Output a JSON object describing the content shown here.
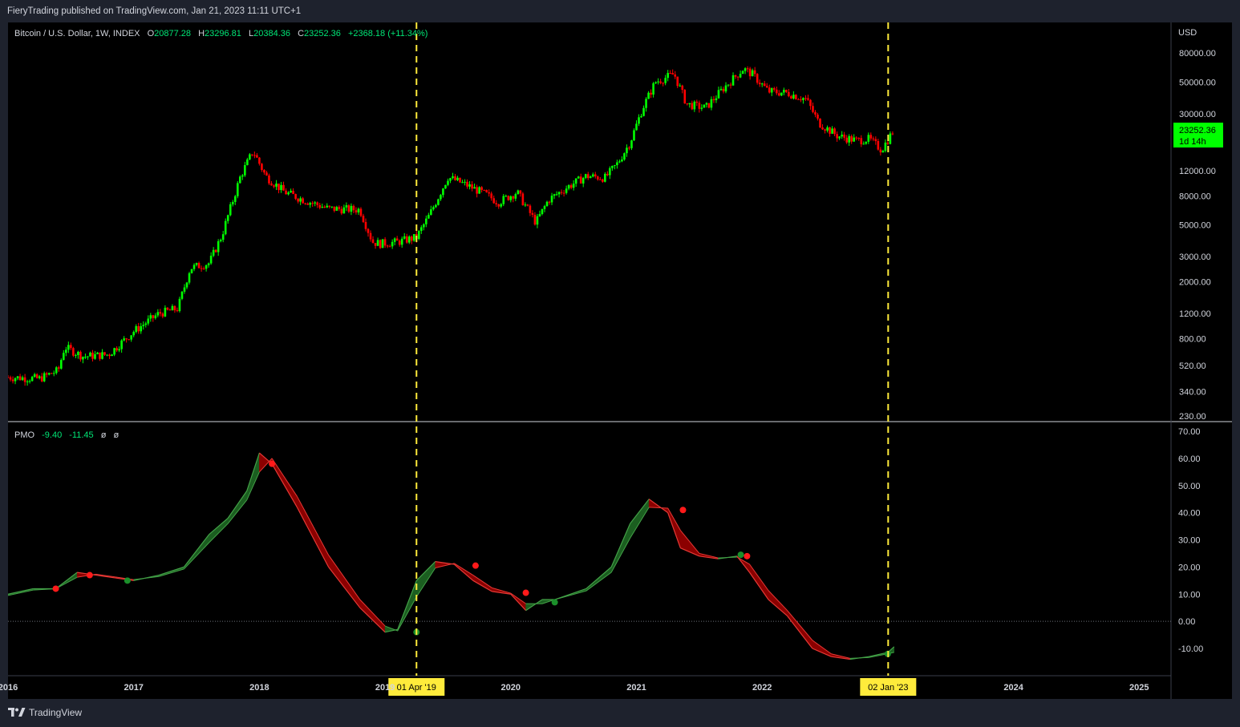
{
  "header": {
    "published": "FieryTrading published on TradingView.com, Jan 21, 2023 11:11 UTC+1"
  },
  "legend": {
    "symbol": "Bitcoin / U.S. Dollar, 1W, INDEX",
    "open_label": "O",
    "open": "20877.28",
    "high_label": "H",
    "high": "23296.81",
    "low_label": "L",
    "low": "20384.36",
    "close_label": "C",
    "close": "23252.36",
    "change": "+2368.18 (+11.34%)"
  },
  "pmo_legend": {
    "name": "PMO",
    "v1": "-9.40",
    "v2": "-11.45",
    "v3": "ø",
    "v4": "ø"
  },
  "price_axis": {
    "currency": "USD",
    "last_price": "23252.36",
    "countdown": "1d 14h"
  },
  "time_markers": [
    {
      "label": "01 Apr '19",
      "date": "2019-04-01"
    },
    {
      "label": "02 Jan '23",
      "date": "2023-01-02"
    }
  ],
  "footer": {
    "brand": "TradingView"
  },
  "colors": {
    "background": "#000000",
    "frame": "#1e222d",
    "bull": "#00ff00",
    "bear": "#ff0000",
    "marker": "#ffeb3b",
    "pmo_up_fill": "#1b5e20",
    "pmo_down_fill": "#8b0000"
  },
  "chart_data": [
    {
      "type": "line",
      "title": "Bitcoin / U.S. Dollar, 1W, INDEX",
      "ylabel": "USD",
      "y_scale": "log",
      "ylim": [
        230,
        100000
      ],
      "y_ticks": [
        "80000.00",
        "50000.00",
        "30000.00",
        "12000.00",
        "8000.00",
        "5000.00",
        "3000.00",
        "2000.00",
        "1200.00",
        "800.00",
        "520.00",
        "340.00",
        "230.00"
      ],
      "x_ticks": [
        "2016",
        "2017",
        "2018",
        "2019",
        "2020",
        "2021",
        "2022",
        "2024",
        "2025"
      ],
      "x": [
        2016.0,
        2016.25,
        2016.4,
        2016.45,
        2016.6,
        2016.8,
        2017.0,
        2017.2,
        2017.35,
        2017.45,
        2017.6,
        2017.7,
        2017.85,
        2017.95,
        2018.05,
        2018.2,
        2018.35,
        2018.55,
        2018.8,
        2018.9,
        2018.96,
        2019.1,
        2019.25,
        2019.35,
        2019.5,
        2019.65,
        2019.8,
        2019.9,
        2020.05,
        2020.2,
        2020.3,
        2020.45,
        2020.6,
        2020.75,
        2020.85,
        2020.95,
        2021.05,
        2021.15,
        2021.3,
        2021.4,
        2021.55,
        2021.7,
        2021.85,
        2021.92,
        2022.05,
        2022.2,
        2022.35,
        2022.45,
        2022.6,
        2022.75,
        2022.85,
        2022.95,
        2023.05
      ],
      "y": [
        430,
        420,
        480,
        700,
        600,
        620,
        900,
        1200,
        1300,
        2500,
        2700,
        4200,
        11000,
        16500,
        11000,
        8500,
        7500,
        6500,
        6400,
        3800,
        3700,
        3800,
        4100,
        5800,
        10800,
        9500,
        8200,
        7200,
        8500,
        5200,
        7500,
        9200,
        11000,
        10700,
        13500,
        19000,
        33000,
        50000,
        57000,
        35000,
        33000,
        46000,
        62000,
        57000,
        43000,
        42000,
        38000,
        26000,
        21000,
        19500,
        20000,
        16800,
        23252
      ]
    },
    {
      "type": "area",
      "title": "PMO",
      "ylim": [
        -20,
        70
      ],
      "y_ticks": [
        "70.00",
        "60.00",
        "50.00",
        "40.00",
        "30.00",
        "20.00",
        "10.00",
        "0.00",
        "-10.00"
      ],
      "series": [
        {
          "name": "PMO",
          "x": [
            2016.0,
            2016.2,
            2016.38,
            2016.55,
            2016.7,
            2016.85,
            2017.0,
            2017.2,
            2017.4,
            2017.6,
            2017.75,
            2017.9,
            2018.0,
            2018.1,
            2018.3,
            2018.55,
            2018.8,
            2019.0,
            2019.1,
            2019.25,
            2019.4,
            2019.55,
            2019.7,
            2019.85,
            2020.0,
            2020.12,
            2020.25,
            2020.35,
            2020.6,
            2020.8,
            2020.95,
            2021.1,
            2021.25,
            2021.35,
            2021.5,
            2021.65,
            2021.8,
            2021.9,
            2022.05,
            2022.2,
            2022.4,
            2022.55,
            2022.7,
            2022.85,
            2023.0,
            2023.05
          ],
          "y": [
            10,
            12,
            12,
            18,
            17,
            16,
            15,
            17,
            20,
            32,
            38,
            48,
            62,
            58,
            42,
            20,
            5,
            -4,
            -3,
            15,
            22,
            21,
            15,
            11,
            10,
            4,
            8,
            8,
            12,
            20,
            36,
            45,
            40,
            27,
            24,
            23,
            24,
            18,
            8,
            2,
            -10,
            -13,
            -14,
            -13,
            -11.45,
            -9.4
          ]
        }
      ],
      "signal_points": [
        {
          "x": 2016.38,
          "y": 12,
          "color": "red"
        },
        {
          "x": 2016.65,
          "y": 17,
          "color": "red"
        },
        {
          "x": 2016.95,
          "y": 15,
          "color": "green"
        },
        {
          "x": 2018.1,
          "y": 58,
          "color": "red"
        },
        {
          "x": 2019.25,
          "y": -4,
          "color": "green"
        },
        {
          "x": 2019.72,
          "y": 20.5,
          "color": "red"
        },
        {
          "x": 2020.12,
          "y": 10.5,
          "color": "red"
        },
        {
          "x": 2020.35,
          "y": 7,
          "color": "green"
        },
        {
          "x": 2021.37,
          "y": 41,
          "color": "red"
        },
        {
          "x": 2021.83,
          "y": 24.5,
          "color": "green"
        },
        {
          "x": 2021.88,
          "y": 24,
          "color": "red"
        },
        {
          "x": 2023.0,
          "y": -12,
          "color": "green"
        }
      ]
    }
  ]
}
